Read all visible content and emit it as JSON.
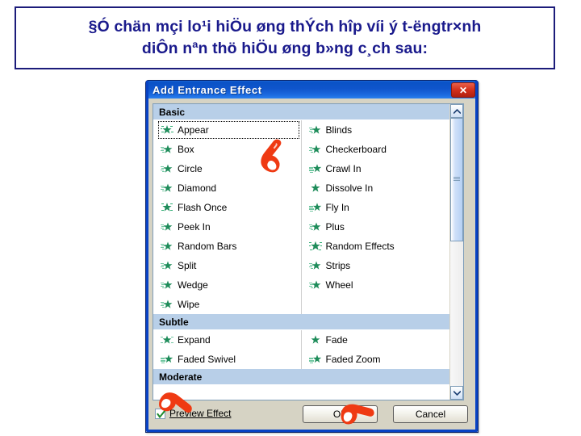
{
  "slide": {
    "title_line1": "§Ó chän mçi lo¹i hiÖu øng thÝch hîp víi ý t-ëngtr×nh",
    "title_line2": "diÔn nªn thö hiÖu øng b»ng c¸ch sau:"
  },
  "dialog": {
    "title": "Add Entrance Effect",
    "close_icon": "close-x-icon",
    "scrollbar": {
      "up_icon": "chevron-up-icon",
      "down_icon": "chevron-down-icon"
    },
    "groups": [
      {
        "name": "Basic",
        "rows": [
          {
            "left": "Appear",
            "right": "Blinds"
          },
          {
            "left": "Box",
            "right": "Checkerboard"
          },
          {
            "left": "Circle",
            "right": "Crawl In"
          },
          {
            "left": "Diamond",
            "right": "Dissolve In"
          },
          {
            "left": "Flash Once",
            "right": "Fly In"
          },
          {
            "left": "Peek In",
            "right": "Plus"
          },
          {
            "left": "Random Bars",
            "right": "Random Effects"
          },
          {
            "left": "Split",
            "right": "Strips"
          },
          {
            "left": "Wedge",
            "right": "Wheel"
          },
          {
            "left": "Wipe",
            "right": ""
          }
        ]
      },
      {
        "name": "Subtle",
        "rows": [
          {
            "left": "Expand",
            "right": "Fade"
          },
          {
            "left": "Faded Swivel",
            "right": "Faded Zoom"
          }
        ]
      },
      {
        "name": "Moderate",
        "rows": []
      }
    ],
    "selected_effect": "Appear",
    "footer": {
      "preview_label": "Preview Effect",
      "preview_checked": true,
      "ok_label": "OK",
      "cancel_label": "Cancel"
    }
  },
  "annotations": [
    {
      "name": "pointer-to-appear",
      "icon": "red-hand-pointer-icon"
    },
    {
      "name": "pointer-to-preview-effect",
      "icon": "red-hand-pointer-icon"
    },
    {
      "name": "pointer-to-ok-button",
      "icon": "red-hand-pointer-icon"
    }
  ],
  "colors": {
    "title_text": "#1a1a8c",
    "titlebar": "#0a52c6",
    "group_header": "#b8cfe8",
    "annotation_red": "#ef3a13",
    "star_green": "#1e8c5a"
  }
}
